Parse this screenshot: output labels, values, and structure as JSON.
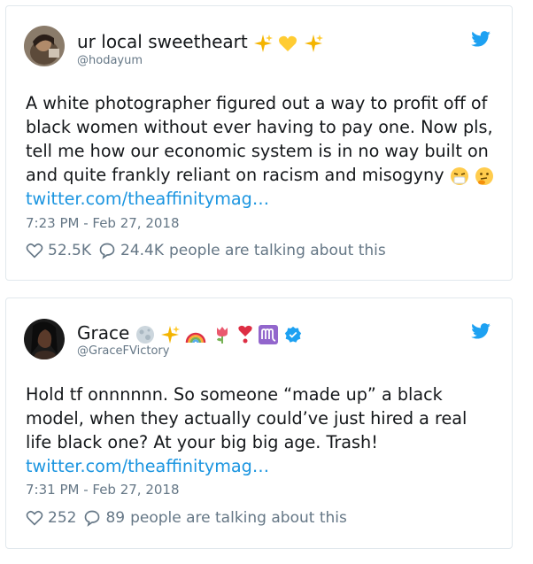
{
  "tweets": [
    {
      "display_name": "ur local sweetheart",
      "handle": "@hodayum",
      "text": "A white photographer figured out a way to profit off of black women without ever having to pay one. Now pls, tell me how our economic system is in no way built on and quite frankly reliant on racism and misogyny",
      "link": "twitter.com/theaffinitymag…",
      "timestamp": "7:23 PM - Feb 27, 2018",
      "likes": "52.5K",
      "replies": "24.4K",
      "talking": "people are talking about this",
      "name_emoji_icons": [
        "sparkles-icon",
        "yellow-heart-icon",
        "sparkles-icon"
      ],
      "text_emoji_icons": [
        "sneezing-face-icon",
        "thinking-face-icon"
      ]
    },
    {
      "display_name": "Grace",
      "handle": "@GraceFVictory",
      "text": "Hold tf onnnnnn. So someone “made up” a black model, when they actually could’ve just hired a real life black one? At your big big age. Trash!",
      "link": "twitter.com/theaffinitymag…",
      "timestamp": "7:31 PM - Feb 27, 2018",
      "likes": "252",
      "replies": "89",
      "talking": "people are talking about this",
      "name_emoji_icons": [
        "full-moon-icon",
        "sparkles-icon",
        "rainbow-icon",
        "tulip-icon",
        "heart-exclamation-icon",
        "virgo-icon",
        "verified-badge-icon"
      ]
    }
  ],
  "colors": {
    "link": "#1b95e0",
    "muted": "#657786",
    "text": "#14171a",
    "border": "#e1e8ed",
    "verified": "#1da1f2"
  }
}
